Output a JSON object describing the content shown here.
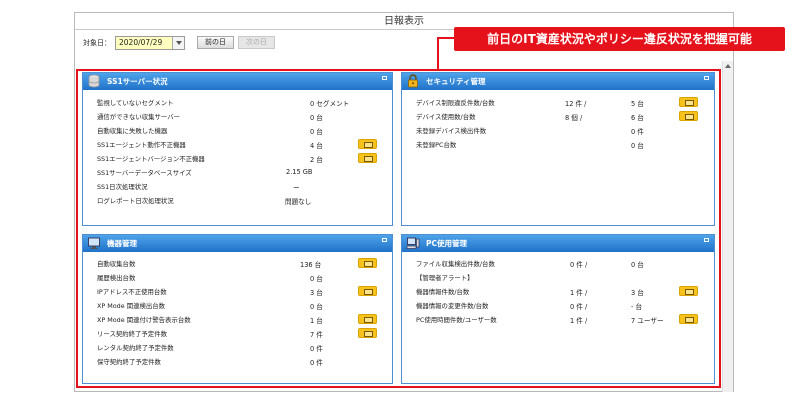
{
  "window": {
    "title": "日報表示"
  },
  "toolbar": {
    "date_label": "対象日：",
    "date_value": "2020/07/29",
    "prev_label": "前の日",
    "next_label": "次の日"
  },
  "callout": {
    "text": "前日のIT資産状況やポリシー違反状況を把握可能"
  },
  "panels": {
    "ss1": {
      "title": "SS1サーバー状況",
      "rows": [
        {
          "label": "監視していないセグメント",
          "value": "0 セグメント"
        },
        {
          "label": "通信ができない収集サーバー",
          "value": "0 台"
        },
        {
          "label": "自動収集に失敗した機器",
          "value": "0 台"
        },
        {
          "label": "SS1エージェント動作不正機器",
          "value": "4 台"
        },
        {
          "label": "SS1エージェントバージョン不正機器",
          "value": "2 台"
        },
        {
          "label": "SS1サーバーデータベースサイズ",
          "value": "2.15 GB"
        },
        {
          "label": "SS1日次処理状況",
          "value": "ー"
        },
        {
          "label": "ログレポート日次処理状況",
          "value": "問題なし"
        }
      ]
    },
    "security": {
      "title": "セキュリティ管理",
      "rows": [
        {
          "label": "デバイス制限違反件数/台数",
          "value1": "12 件 /",
          "value2": "5 台"
        },
        {
          "label": "デバイス使用数/台数",
          "value1": "8 個 /",
          "value2": "6 台"
        },
        {
          "label": "未登録デバイス検出件数",
          "value1": "",
          "value2": "0 件"
        },
        {
          "label": "未登録PC台数",
          "value1": "",
          "value2": "0 台"
        }
      ]
    },
    "devices": {
      "title": "機器管理",
      "rows": [
        {
          "label": "自動収集台数",
          "value": "136 台"
        },
        {
          "label": "履歴検出台数",
          "value": "0 台"
        },
        {
          "label": "IPアドレス不正使用台数",
          "value": "3 台"
        },
        {
          "label": "XP Mode 関連検出台数",
          "value": "0 台"
        },
        {
          "label": "XP Mode 関連付け警告表示台数",
          "value": "1 台"
        },
        {
          "label": "リース契約終了予定件数",
          "value": "7 件"
        },
        {
          "label": "レンタル契約終了予定件数",
          "value": "0 件"
        },
        {
          "label": "保守契約終了予定件数",
          "value": "0 件"
        }
      ]
    },
    "pcusage": {
      "title": "PC使用管理",
      "rows": [
        {
          "label": "ファイル収集検出件数/台数",
          "value1": "0 件 /",
          "value2": "0 台"
        },
        {
          "label": "【管理者アラート】",
          "value1": "",
          "value2": ""
        },
        {
          "label": "機器情報件数/台数",
          "value1": "1 件 /",
          "value2": "3 台"
        },
        {
          "label": "機器情報の変更件数/台数",
          "value1": "0 件 /",
          "value2": "- 台"
        },
        {
          "label": "PC使用時間件数/ユーザー数",
          "value1": "1 件 /",
          "value2": "7 ユーザー"
        }
      ]
    }
  },
  "colors": {
    "accent_red": "#e5121b",
    "panel_header_blue": "#1f72c8",
    "detail_button_yellow": "#f7c21b",
    "date_field_yellow": "#ffffc0"
  }
}
